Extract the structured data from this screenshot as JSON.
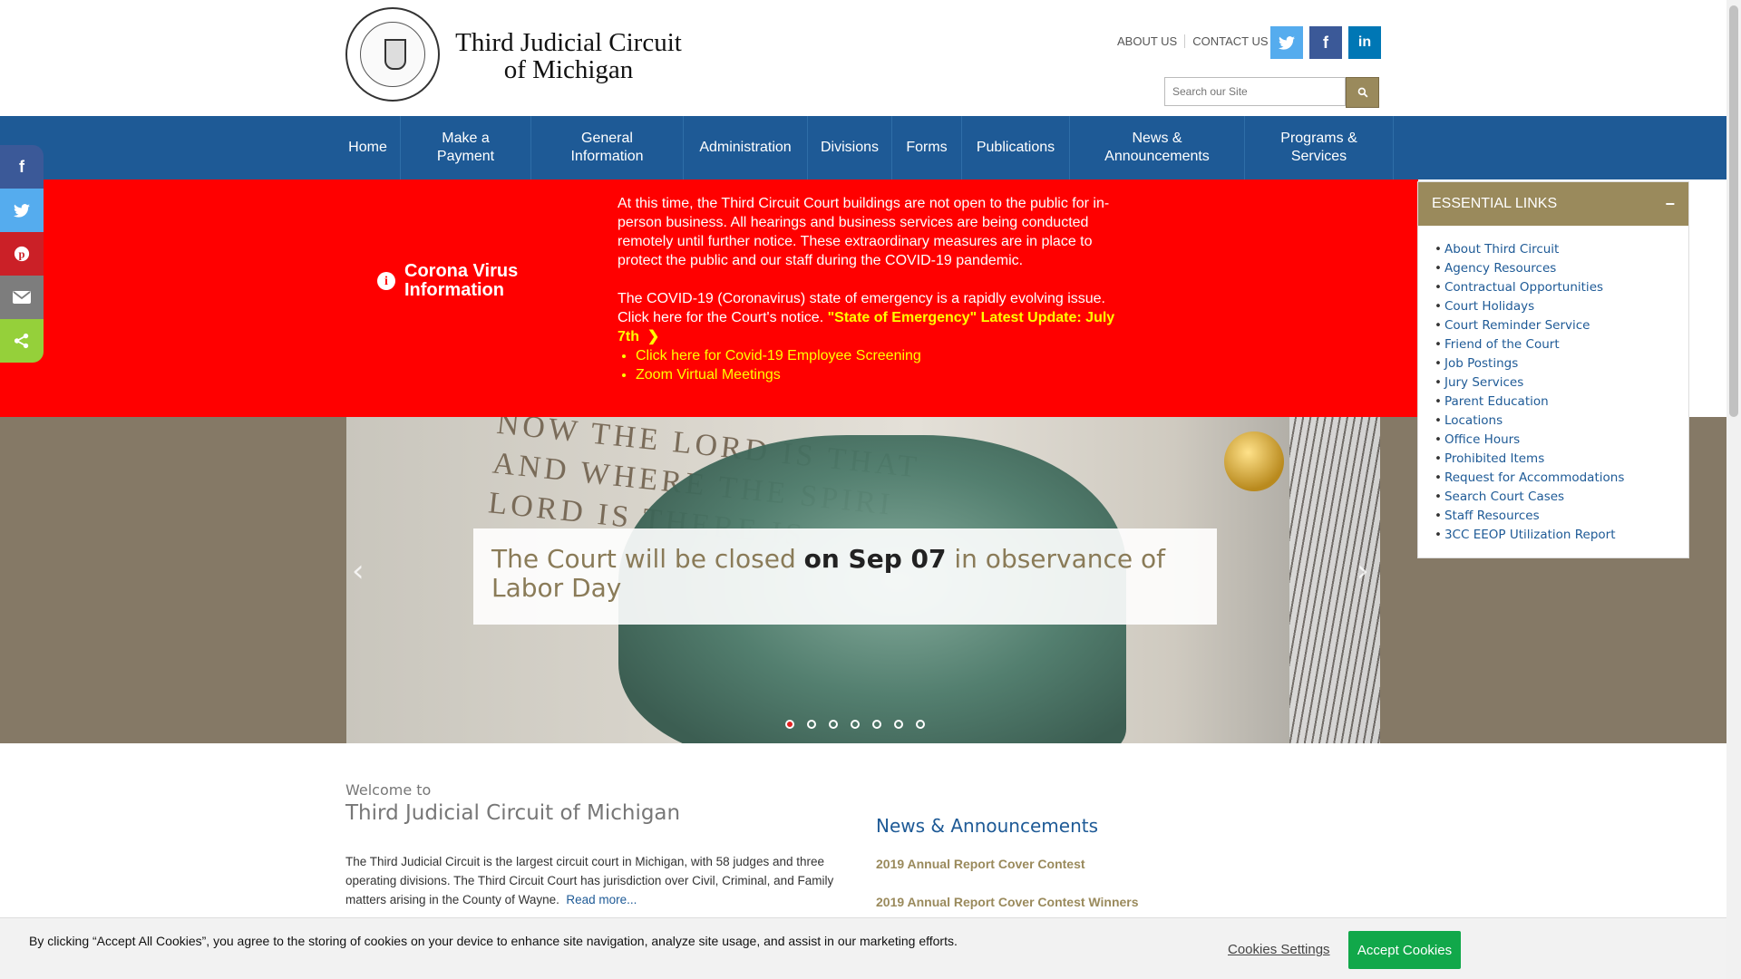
{
  "header": {
    "logo_line1": "Third Judicial Circuit",
    "logo_line2": "of Michigan",
    "top_links": [
      "ABOUT US",
      "CONTACT US"
    ],
    "social": [
      {
        "name": "twitter",
        "glyph": "t",
        "color": "#55acee"
      },
      {
        "name": "facebook",
        "glyph": "f",
        "color": "#3b5998"
      },
      {
        "name": "linkedin",
        "glyph": "in",
        "color": "#0077b5"
      }
    ],
    "search_placeholder": "Search our Site"
  },
  "nav": {
    "items": [
      "Home",
      "Make a Payment",
      "General Information",
      "Administration",
      "Divisions",
      "Forms",
      "Publications",
      "News & Announcements",
      "Programs & Services"
    ]
  },
  "share_bar": [
    {
      "name": "facebook",
      "glyph": "f",
      "color": "#3b5998"
    },
    {
      "name": "twitter",
      "glyph": "t",
      "color": "#55acee"
    },
    {
      "name": "pinterest",
      "glyph": "p",
      "color": "#cb2027"
    },
    {
      "name": "email",
      "glyph": "✉",
      "color": "#7d7d7d"
    },
    {
      "name": "share",
      "glyph": "<",
      "color": "#95d03a"
    }
  ],
  "alert": {
    "heading_line1": "Corona Virus",
    "heading_line2": "Information",
    "para1": "At this time, the Third Circuit Court buildings are not open to the public for in-person business. All hearings and business services are being conducted remotely until further notice. These extraordinary measures are in place to protect the public and our staff during the COVID-19 pandemic.",
    "para2": "The COVID-19 (Coronavirus) state of emergency is a rapidly evolving issue. Click  here  for the Court's notice. ",
    "update_link": "\"State of Emergency\" Latest Update: July 7th",
    "list": [
      "Click here for Covid-19 Employee Screening",
      "Zoom Virtual Meetings"
    ],
    "color": "#ff0000"
  },
  "slider": {
    "wall_text_1": "NOW THE LORD IS THAT",
    "wall_text_2": "AND WHERE THE SPIRI",
    "wall_text_3": "LORD IS THERE IS",
    "caption_pre": "The Court will be closed ",
    "caption_bold": "on Sep 07",
    "caption_post": " in observance of Labor Day",
    "slide_count": 7,
    "active_slide": 1
  },
  "essential_links": {
    "title": "ESSENTIAL LINKS",
    "items": [
      "About Third Circuit",
      "Agency Resources",
      "Contractual Opportunities",
      "Court Holidays",
      "Court Reminder Service",
      "Friend of the Court",
      "Job Postings",
      "Jury Services",
      "Parent Education",
      "Locations",
      "Office Hours",
      "Prohibited Items",
      "Request for Accommodations",
      "Search Court Cases",
      "Staff Resources",
      "3CC EEOP Utilization Report"
    ]
  },
  "welcome": {
    "small": "Welcome to",
    "title": "Third Judicial Circuit of Michigan",
    "body": "The Third Judicial Circuit is the largest circuit court in Michigan, with 58 judges and three operating divisions. The Third Circuit Court has jurisdiction over Civil, Criminal, and Family matters arising in the County of Wayne.",
    "read_more": "Read more..."
  },
  "news": {
    "title": "News & Announcements",
    "items": [
      "2019 Annual Report Cover Contest",
      "2019 Annual Report Cover Contest Winners"
    ]
  },
  "cookie": {
    "text": "By clicking “Accept All Cookies”, you agree to the storing of cookies on your device to enhance site navigation, analyze site usage, and assist in our marketing efforts.",
    "settings_label": "Cookies Settings",
    "accept_label": "Accept Cookies"
  }
}
